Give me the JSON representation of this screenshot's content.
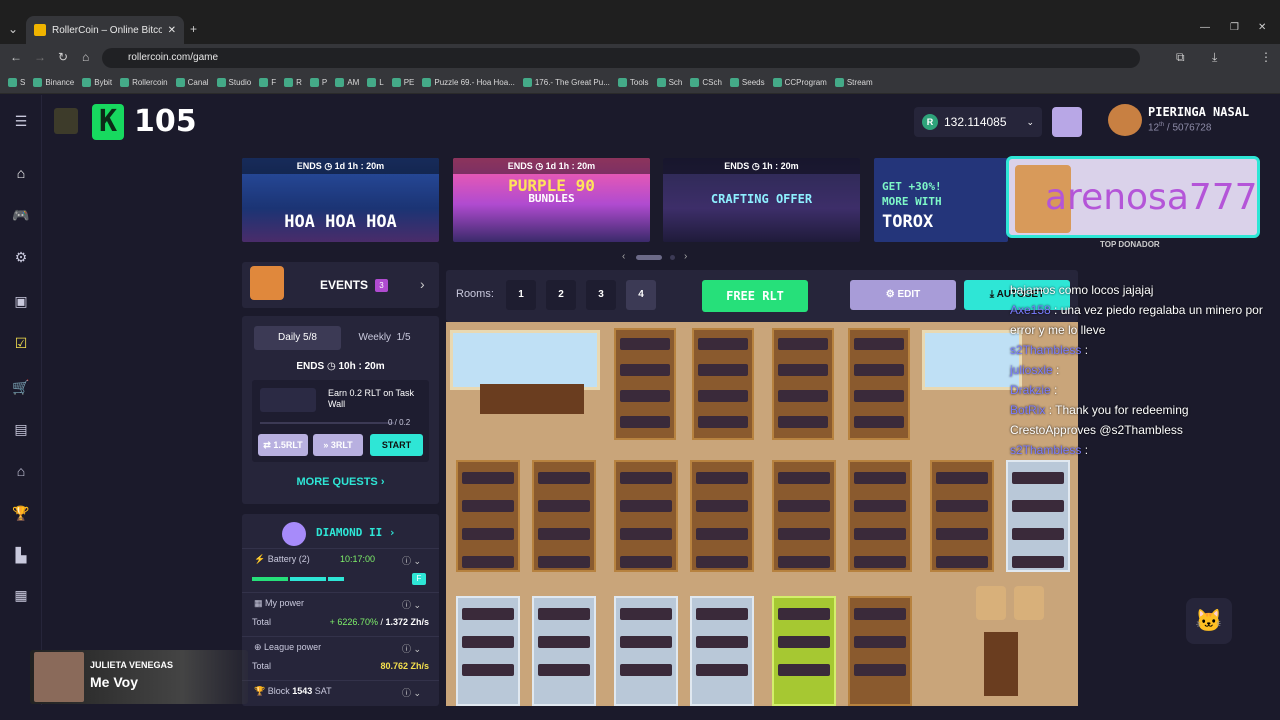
{
  "browser": {
    "tab_title": "RollerCoin – Online Bitcoin Mi",
    "url": "rollercoin.com/game",
    "bookmarks": [
      "S",
      "Binance",
      "Bybit",
      "Rollercoin",
      "Canal",
      "Studio",
      "F",
      "R",
      "P",
      "AM",
      "L",
      "PE",
      "Puzzle 69.- Hoa Hoa...",
      "176.- The Great Pu...",
      "Tools",
      "Sch",
      "CSch",
      "Seeds",
      "CCProgram",
      "Stream"
    ]
  },
  "header": {
    "level": "105",
    "balance": "132.114085",
    "balance_currency": "R",
    "username": "PIERINGA NASAL",
    "rank_num": "12",
    "rank_suffix": "th",
    "rank_total": "/ 5076728"
  },
  "banners": [
    {
      "ends": "ENDS",
      "time": "1d 1h : 20m",
      "title": "HOA HOA HOA"
    },
    {
      "ends": "ENDS",
      "time": "1d 1h : 20m",
      "title": "PURPLE 90",
      "subtitle": "BUNDLES"
    },
    {
      "ends": "ENDS",
      "time": "1h : 20m",
      "title": "CRAFTING OFFER"
    },
    {
      "title_line1": "GET +30%!",
      "title_line2": "MORE WITH",
      "title_line3": "TOROX"
    }
  ],
  "donor": {
    "name": "arenosa777",
    "label": "TOP DONADOR"
  },
  "events": {
    "title": "EVENTS",
    "count": "3",
    "tab_daily": "Daily",
    "daily_progress": "5/8",
    "tab_weekly": "Weekly",
    "weekly_progress": "1/5",
    "ends": "ENDS",
    "ends_time": "10h : 20m",
    "quest_text": "Earn 0.2 RLT on Task Wall",
    "quest_progress": "0 / 0.2",
    "btn_a": "1.5RLT",
    "btn_b": "3RLT",
    "btn_start": "START",
    "more_quests": "MORE QUESTS"
  },
  "league": {
    "name": "DIAMOND II",
    "battery_label": "Battery (2)",
    "battery_time": "10:17:00",
    "my_power_label": "My power",
    "total_label": "Total",
    "my_power_pct": "+ 6226.70%",
    "my_power_total": "1.372 Zh/s",
    "league_power_label": "League power",
    "league_total": "80.762 Zh/s",
    "block_label": "Block",
    "block_num": "1543",
    "block_unit": "SAT"
  },
  "rooms": {
    "label": "Rooms:",
    "items": [
      "1",
      "2",
      "3",
      "4"
    ],
    "active": "4",
    "free_rlt": "FREE RLT",
    "edit": "EDIT",
    "autoset": "AUTOSET"
  },
  "chat": [
    {
      "user": "",
      "text": "bajamos como locos jajajaj"
    },
    {
      "user": "Axe158",
      "text": ": una vez piedo regalaba un minero por error y me lo lleve"
    },
    {
      "user": "s2Thambless",
      "text": ":"
    },
    {
      "user": "juliosxle",
      "text": ":"
    },
    {
      "user": "Drakzie",
      "text": ":"
    },
    {
      "user": "BotRix",
      "text": ": Thank you for redeeming CrestoApproves @s2Thambless"
    },
    {
      "user": "s2Thambless",
      "text": ":"
    }
  ],
  "music": {
    "artist": "JULIETA VENEGAS",
    "song": "Me Voy"
  },
  "colors": {
    "accent_green": "#26e07a",
    "teal": "#2ee6d6",
    "panel": "#26253a",
    "bg": "#1b1a2b",
    "purple": "#a78bfa"
  }
}
